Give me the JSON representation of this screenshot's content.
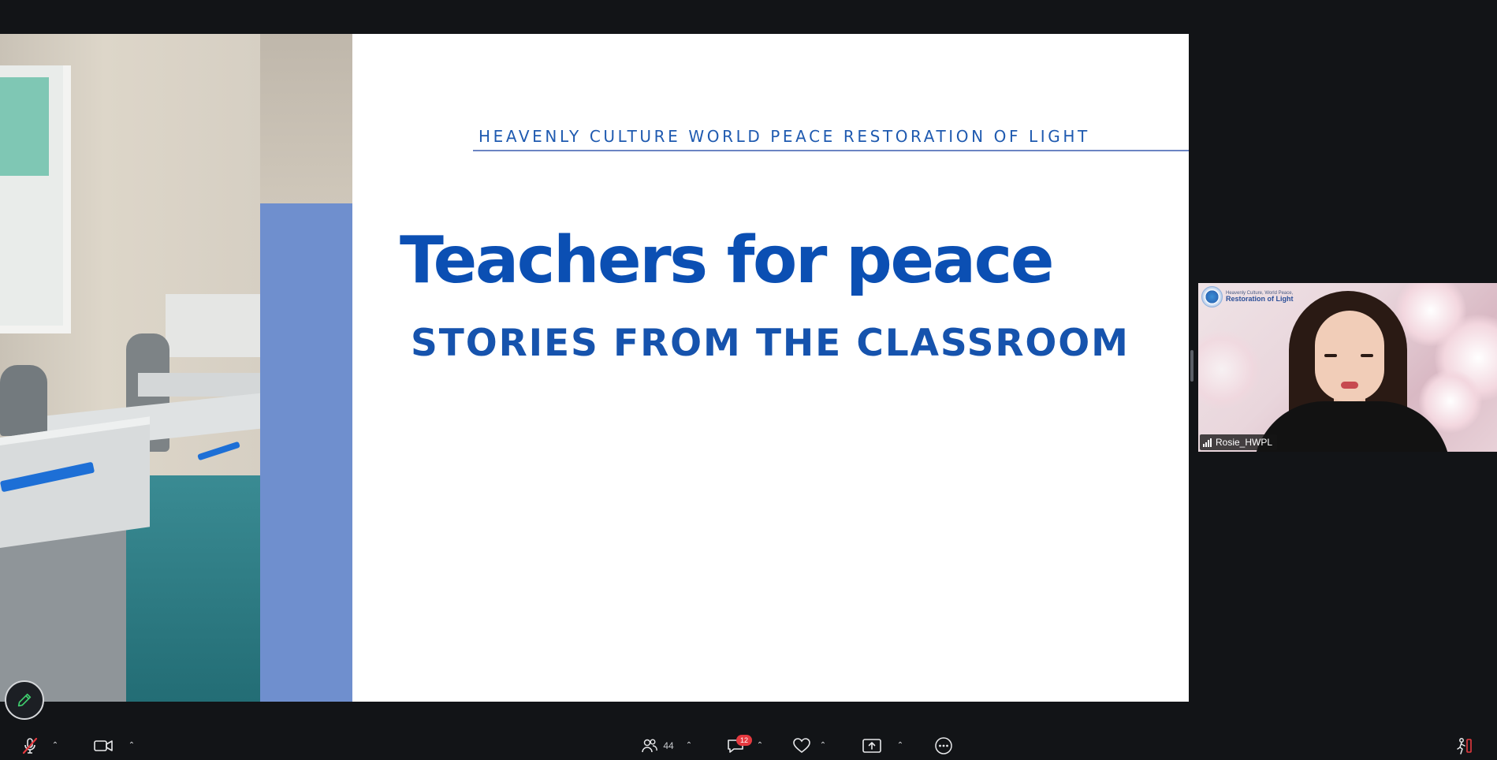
{
  "slide": {
    "header": "HEAVENLY CULTURE WORLD PEACE RESTORATION OF LIGHT",
    "title": "Teachers for peace",
    "subtitle": "STORIES FROM THE CLASSROOM"
  },
  "participant": {
    "name": "Rosie_HWPL",
    "logo_small": "Heavenly Culture, World Peace,",
    "logo_big": "Restoration of Light"
  },
  "toolbar": {
    "participants_count": "44",
    "chat_badge": "12"
  },
  "colors": {
    "background": "#121417",
    "slide_blue": "#0b4fb3",
    "accent_band": "#6f8fce",
    "badge": "#e5393f",
    "mic_muted": "#e5393f"
  },
  "icons": {
    "annotate": "pencil-icon",
    "mic": "mic-muted-icon",
    "video": "video-camera-icon",
    "participants": "people-icon",
    "chat": "chat-bubble-icon",
    "reactions": "heart-icon",
    "share": "share-screen-icon",
    "more": "more-options-icon",
    "apps": "apps-icon"
  }
}
